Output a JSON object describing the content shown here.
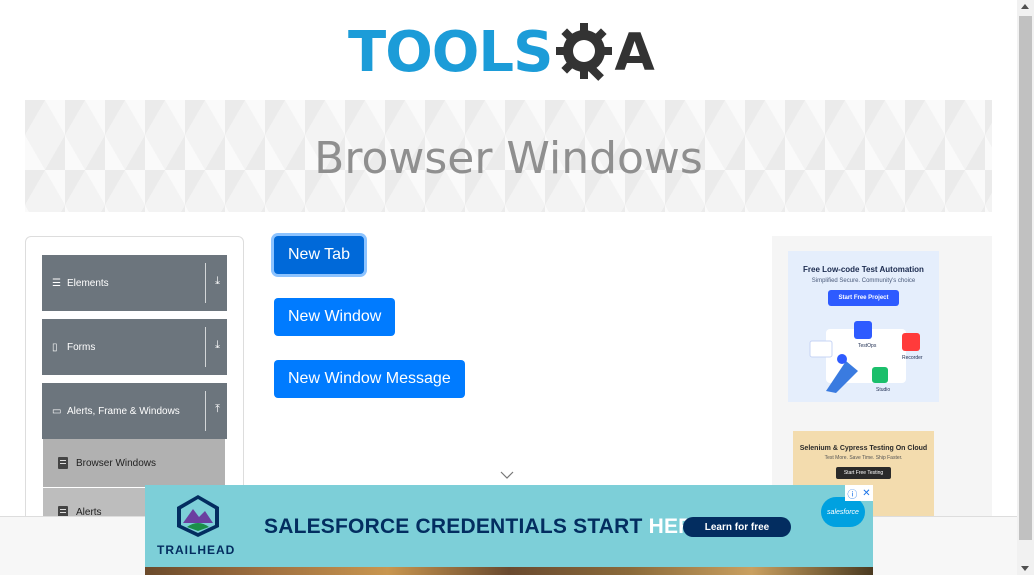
{
  "logo": {
    "tools_text": "TOOLS",
    "a_text": "A"
  },
  "banner": {
    "title": "Browser Windows"
  },
  "sidebar": {
    "groups": [
      {
        "label": "Elements",
        "icon": "hamburger-icon",
        "arrow": "⤓"
      },
      {
        "label": "Forms",
        "icon": "file-icon",
        "arrow": "⤓"
      },
      {
        "label": "Alerts, Frame & Windows",
        "icon": "window-icon",
        "arrow": "⤒"
      }
    ],
    "items": [
      {
        "label": "Browser Windows",
        "active": true
      },
      {
        "label": "Alerts",
        "active": false
      }
    ]
  },
  "buttons": {
    "new_tab": "New Tab",
    "new_window": "New Window",
    "new_window_message": "New Window Message"
  },
  "right_ads": {
    "ad1": {
      "title": "Free Low-code Test Automation",
      "subtitle": "Simplified Secure. Community's choice",
      "cta": "Start Free Project",
      "labels": [
        "TestOps",
        "Recorder",
        "Studio"
      ]
    },
    "ad2": {
      "title": "Selenium & Cypress Testing On Cloud",
      "subtitle": "Test More. Save Time. Ship Faster.",
      "cta": "Start Free Testing"
    }
  },
  "bottom_ad": {
    "brand": "TRAILHEAD",
    "headline_main": "SALESFORCE CREDENTIALS START ",
    "headline_highlight": "HERE.",
    "cta": "Learn for free",
    "logo_text": "salesforce",
    "colors": {
      "background": "#7dcfd8",
      "navy": "#032d60",
      "button": "#032d60"
    }
  },
  "colors": {
    "primary": "#007bff",
    "sidebar_header": "#6c757d",
    "banner_text": "#8f8f8f",
    "logo_blue": "#1c9cd8"
  }
}
